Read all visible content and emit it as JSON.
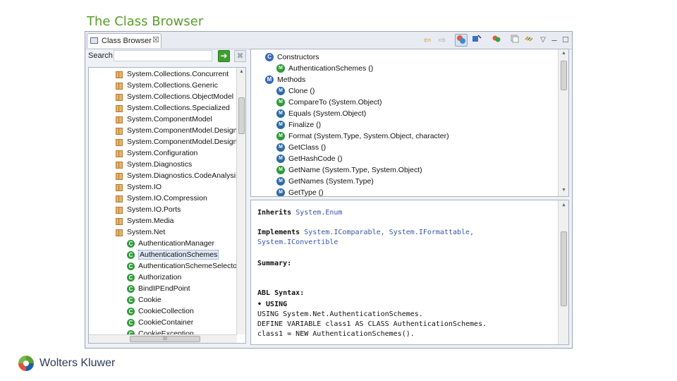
{
  "slide": {
    "title": "The Class Browser"
  },
  "tab": {
    "label": "Class Browser",
    "close": "☒"
  },
  "toolbar": {
    "back": "⇦",
    "forward": "⇨",
    "minimize": "–",
    "maximize": "☐",
    "menu": "▽"
  },
  "search": {
    "label": "Search",
    "value": "",
    "go": "➔",
    "clear": "✖"
  },
  "tree": {
    "items": [
      {
        "label": "System.Collections.Concurrent",
        "kind": "namespace"
      },
      {
        "label": "System.Collections.Generic",
        "kind": "namespace"
      },
      {
        "label": "System.Collections.ObjectModel",
        "kind": "namespace"
      },
      {
        "label": "System.Collections.Specialized",
        "kind": "namespace"
      },
      {
        "label": "System.ComponentModel",
        "kind": "namespace"
      },
      {
        "label": "System.ComponentModel.Design",
        "kind": "namespace"
      },
      {
        "label": "System.ComponentModel.Design",
        "kind": "namespace"
      },
      {
        "label": "System.Configuration",
        "kind": "namespace"
      },
      {
        "label": "System.Diagnostics",
        "kind": "namespace"
      },
      {
        "label": "System.Diagnostics.CodeAnalysis",
        "kind": "namespace"
      },
      {
        "label": "System.IO",
        "kind": "namespace"
      },
      {
        "label": "System.IO.Compression",
        "kind": "namespace"
      },
      {
        "label": "System.IO.Ports",
        "kind": "namespace"
      },
      {
        "label": "System.Media",
        "kind": "namespace"
      },
      {
        "label": "System.Net",
        "kind": "namespace"
      },
      {
        "label": "AuthenticationManager",
        "kind": "class"
      },
      {
        "label": "AuthenticationSchemes",
        "kind": "class",
        "selected": true
      },
      {
        "label": "AuthenticationSchemeSelector",
        "kind": "class"
      },
      {
        "label": "Authorization",
        "kind": "class"
      },
      {
        "label": "BindIPEndPoint",
        "kind": "class"
      },
      {
        "label": "Cookie",
        "kind": "class"
      },
      {
        "label": "CookieCollection",
        "kind": "class"
      },
      {
        "label": "CookieContainer",
        "kind": "class"
      },
      {
        "label": "CookieException",
        "kind": "class"
      }
    ],
    "hscroll_grip": "III"
  },
  "members": {
    "items": [
      {
        "label": "Constructors",
        "kind": "group"
      },
      {
        "label": "AuthenticationSchemes ()",
        "kind": "ctor"
      },
      {
        "label": "Methods",
        "kind": "group"
      },
      {
        "label": "Clone ()",
        "kind": "method"
      },
      {
        "label": "CompareTo (System.Object)",
        "kind": "method"
      },
      {
        "label": "Equals (System.Object)",
        "kind": "method"
      },
      {
        "label": "Finalize ()",
        "kind": "method"
      },
      {
        "label": "Format (System.Type, System.Object, character)",
        "kind": "method"
      },
      {
        "label": "GetClass ()",
        "kind": "method"
      },
      {
        "label": "GetHashCode ()",
        "kind": "method"
      },
      {
        "label": "GetName (System.Type, System.Object)",
        "kind": "method"
      },
      {
        "label": "GetNames (System.Type)",
        "kind": "method"
      },
      {
        "label": "GetType ()",
        "kind": "method"
      }
    ]
  },
  "doc": {
    "inherits_label": "Inherits",
    "inherits_value": "System.Enum",
    "implements_label": "Implements",
    "implements_1": "System.IComparable,",
    "implements_2": "System.IFormattable,",
    "implements_3": "System.IConvertible",
    "summary_label": "Summary:",
    "abl_label": "ABL Syntax:",
    "using_label": "• USING",
    "code_1": "USING System.Net.AuthenticationSchemes.",
    "code_2": "DEFINE VARIABLE class1 AS CLASS AuthenticationSchemes.",
    "code_3": "class1 = NEW AuthenticationSchemes()."
  },
  "footer": {
    "brand": "Wolters Kluwer"
  }
}
